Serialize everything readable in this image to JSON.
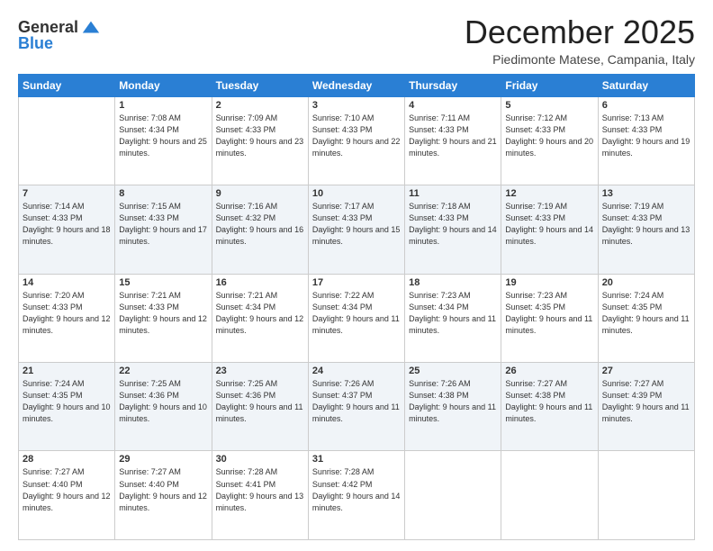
{
  "logo": {
    "general": "General",
    "blue": "Blue"
  },
  "header": {
    "month": "December 2025",
    "location": "Piedimonte Matese, Campania, Italy"
  },
  "days_of_week": [
    "Sunday",
    "Monday",
    "Tuesday",
    "Wednesday",
    "Thursday",
    "Friday",
    "Saturday"
  ],
  "weeks": [
    [
      {
        "day": "",
        "sunrise": "",
        "sunset": "",
        "daylight": ""
      },
      {
        "day": "1",
        "sunrise": "Sunrise: 7:08 AM",
        "sunset": "Sunset: 4:34 PM",
        "daylight": "Daylight: 9 hours and 25 minutes."
      },
      {
        "day": "2",
        "sunrise": "Sunrise: 7:09 AM",
        "sunset": "Sunset: 4:33 PM",
        "daylight": "Daylight: 9 hours and 23 minutes."
      },
      {
        "day": "3",
        "sunrise": "Sunrise: 7:10 AM",
        "sunset": "Sunset: 4:33 PM",
        "daylight": "Daylight: 9 hours and 22 minutes."
      },
      {
        "day": "4",
        "sunrise": "Sunrise: 7:11 AM",
        "sunset": "Sunset: 4:33 PM",
        "daylight": "Daylight: 9 hours and 21 minutes."
      },
      {
        "day": "5",
        "sunrise": "Sunrise: 7:12 AM",
        "sunset": "Sunset: 4:33 PM",
        "daylight": "Daylight: 9 hours and 20 minutes."
      },
      {
        "day": "6",
        "sunrise": "Sunrise: 7:13 AM",
        "sunset": "Sunset: 4:33 PM",
        "daylight": "Daylight: 9 hours and 19 minutes."
      }
    ],
    [
      {
        "day": "7",
        "sunrise": "Sunrise: 7:14 AM",
        "sunset": "Sunset: 4:33 PM",
        "daylight": "Daylight: 9 hours and 18 minutes."
      },
      {
        "day": "8",
        "sunrise": "Sunrise: 7:15 AM",
        "sunset": "Sunset: 4:33 PM",
        "daylight": "Daylight: 9 hours and 17 minutes."
      },
      {
        "day": "9",
        "sunrise": "Sunrise: 7:16 AM",
        "sunset": "Sunset: 4:32 PM",
        "daylight": "Daylight: 9 hours and 16 minutes."
      },
      {
        "day": "10",
        "sunrise": "Sunrise: 7:17 AM",
        "sunset": "Sunset: 4:33 PM",
        "daylight": "Daylight: 9 hours and 15 minutes."
      },
      {
        "day": "11",
        "sunrise": "Sunrise: 7:18 AM",
        "sunset": "Sunset: 4:33 PM",
        "daylight": "Daylight: 9 hours and 14 minutes."
      },
      {
        "day": "12",
        "sunrise": "Sunrise: 7:19 AM",
        "sunset": "Sunset: 4:33 PM",
        "daylight": "Daylight: 9 hours and 14 minutes."
      },
      {
        "day": "13",
        "sunrise": "Sunrise: 7:19 AM",
        "sunset": "Sunset: 4:33 PM",
        "daylight": "Daylight: 9 hours and 13 minutes."
      }
    ],
    [
      {
        "day": "14",
        "sunrise": "Sunrise: 7:20 AM",
        "sunset": "Sunset: 4:33 PM",
        "daylight": "Daylight: 9 hours and 12 minutes."
      },
      {
        "day": "15",
        "sunrise": "Sunrise: 7:21 AM",
        "sunset": "Sunset: 4:33 PM",
        "daylight": "Daylight: 9 hours and 12 minutes."
      },
      {
        "day": "16",
        "sunrise": "Sunrise: 7:21 AM",
        "sunset": "Sunset: 4:34 PM",
        "daylight": "Daylight: 9 hours and 12 minutes."
      },
      {
        "day": "17",
        "sunrise": "Sunrise: 7:22 AM",
        "sunset": "Sunset: 4:34 PM",
        "daylight": "Daylight: 9 hours and 11 minutes."
      },
      {
        "day": "18",
        "sunrise": "Sunrise: 7:23 AM",
        "sunset": "Sunset: 4:34 PM",
        "daylight": "Daylight: 9 hours and 11 minutes."
      },
      {
        "day": "19",
        "sunrise": "Sunrise: 7:23 AM",
        "sunset": "Sunset: 4:35 PM",
        "daylight": "Daylight: 9 hours and 11 minutes."
      },
      {
        "day": "20",
        "sunrise": "Sunrise: 7:24 AM",
        "sunset": "Sunset: 4:35 PM",
        "daylight": "Daylight: 9 hours and 11 minutes."
      }
    ],
    [
      {
        "day": "21",
        "sunrise": "Sunrise: 7:24 AM",
        "sunset": "Sunset: 4:35 PM",
        "daylight": "Daylight: 9 hours and 10 minutes."
      },
      {
        "day": "22",
        "sunrise": "Sunrise: 7:25 AM",
        "sunset": "Sunset: 4:36 PM",
        "daylight": "Daylight: 9 hours and 10 minutes."
      },
      {
        "day": "23",
        "sunrise": "Sunrise: 7:25 AM",
        "sunset": "Sunset: 4:36 PM",
        "daylight": "Daylight: 9 hours and 11 minutes."
      },
      {
        "day": "24",
        "sunrise": "Sunrise: 7:26 AM",
        "sunset": "Sunset: 4:37 PM",
        "daylight": "Daylight: 9 hours and 11 minutes."
      },
      {
        "day": "25",
        "sunrise": "Sunrise: 7:26 AM",
        "sunset": "Sunset: 4:38 PM",
        "daylight": "Daylight: 9 hours and 11 minutes."
      },
      {
        "day": "26",
        "sunrise": "Sunrise: 7:27 AM",
        "sunset": "Sunset: 4:38 PM",
        "daylight": "Daylight: 9 hours and 11 minutes."
      },
      {
        "day": "27",
        "sunrise": "Sunrise: 7:27 AM",
        "sunset": "Sunset: 4:39 PM",
        "daylight": "Daylight: 9 hours and 11 minutes."
      }
    ],
    [
      {
        "day": "28",
        "sunrise": "Sunrise: 7:27 AM",
        "sunset": "Sunset: 4:40 PM",
        "daylight": "Daylight: 9 hours and 12 minutes."
      },
      {
        "day": "29",
        "sunrise": "Sunrise: 7:27 AM",
        "sunset": "Sunset: 4:40 PM",
        "daylight": "Daylight: 9 hours and 12 minutes."
      },
      {
        "day": "30",
        "sunrise": "Sunrise: 7:28 AM",
        "sunset": "Sunset: 4:41 PM",
        "daylight": "Daylight: 9 hours and 13 minutes."
      },
      {
        "day": "31",
        "sunrise": "Sunrise: 7:28 AM",
        "sunset": "Sunset: 4:42 PM",
        "daylight": "Daylight: 9 hours and 14 minutes."
      },
      {
        "day": "",
        "sunrise": "",
        "sunset": "",
        "daylight": ""
      },
      {
        "day": "",
        "sunrise": "",
        "sunset": "",
        "daylight": ""
      },
      {
        "day": "",
        "sunrise": "",
        "sunset": "",
        "daylight": ""
      }
    ]
  ]
}
